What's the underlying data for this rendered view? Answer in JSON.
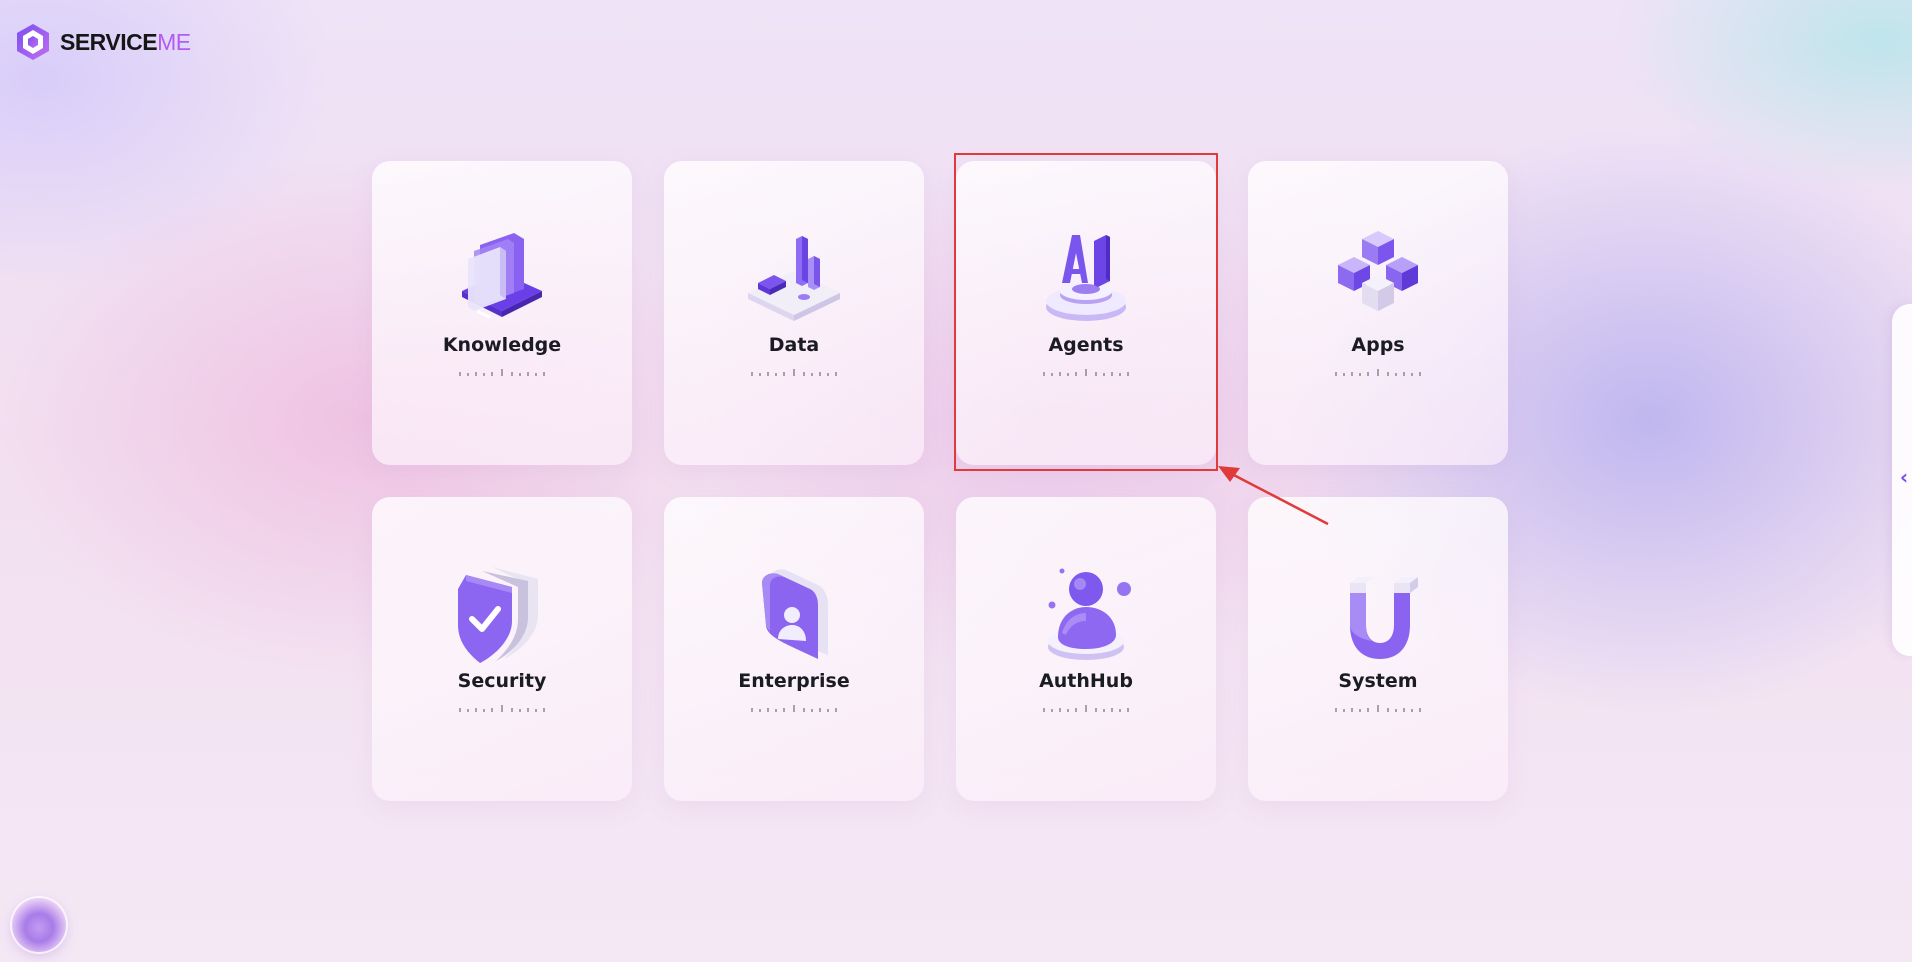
{
  "brand": {
    "name_primary": "SERVICE",
    "name_accent": "ME",
    "accent_color": "#b25cf0"
  },
  "cards": [
    {
      "label": "Knowledge",
      "icon": "knowledge-book-icon"
    },
    {
      "label": "Data",
      "icon": "data-chart-icon"
    },
    {
      "label": "Agents",
      "icon": "ai-agent-icon"
    },
    {
      "label": "Apps",
      "icon": "apps-cubes-icon"
    },
    {
      "label": "Security",
      "icon": "shield-check-icon"
    },
    {
      "label": "Enterprise",
      "icon": "enterprise-badge-icon"
    },
    {
      "label": "AuthHub",
      "icon": "user-auth-icon"
    },
    {
      "label": "System",
      "icon": "magnet-system-icon"
    }
  ],
  "highlighted_card": "Agents",
  "highlight_color": "#e03a3a",
  "drawer_toggle": {
    "icon": "chevron-left-icon",
    "glyph": "‹"
  },
  "assistant_orb": {
    "icon": "assistant-orb-icon"
  }
}
